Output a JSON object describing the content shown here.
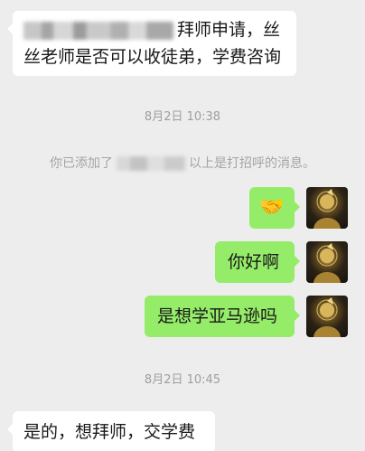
{
  "messages": {
    "m1_text": "拜师申请，丝丝老师是否可以收徒弟，学费咨询",
    "ts1": "8月2日 10:38",
    "system_pre": "你已添加了",
    "system_post": "以上是打招呼的消息。",
    "m2_emoji": "🤝",
    "m3_text": "你好啊",
    "m4_text": "是想学亚马逊吗",
    "ts2": "8月2日 10:45",
    "m5_text": "是的，想拜师，交学费"
  },
  "avatar": {
    "icon": "user-avatar-icon"
  },
  "colors": {
    "background": "#ededed",
    "incoming_bubble": "#ffffff",
    "outgoing_bubble": "#95ec69"
  }
}
